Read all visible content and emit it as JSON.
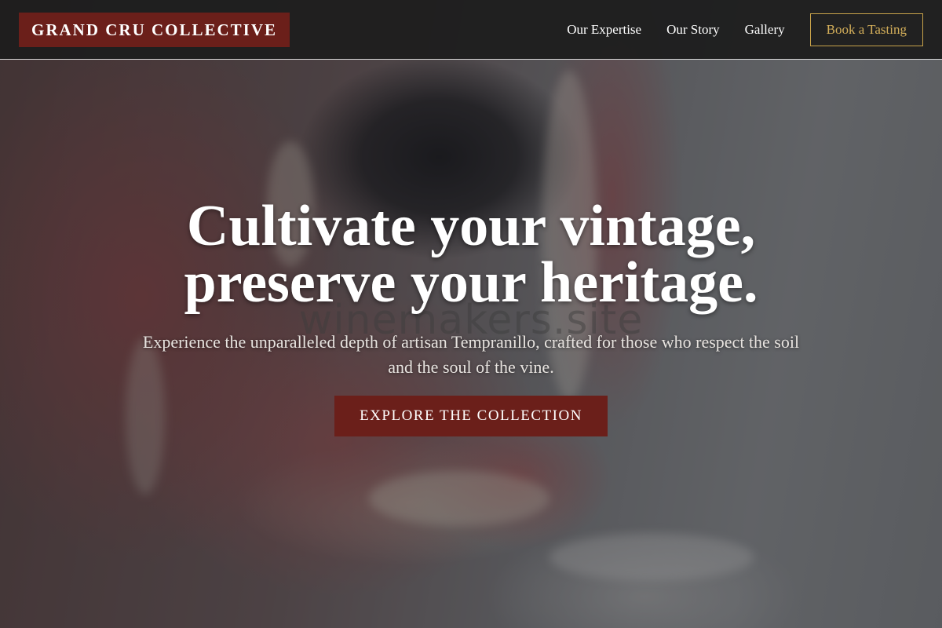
{
  "navbar": {
    "brand": "GRAND CRU COLLECTIVE",
    "links": [
      {
        "label": "Our Expertise"
      },
      {
        "label": "Our Story"
      },
      {
        "label": "Gallery"
      }
    ],
    "cta_label": "Book a Tasting"
  },
  "hero": {
    "headline_line1": "Cultivate your vintage,",
    "headline_line2": "preserve your heritage.",
    "subtext": "Experience the unparalleled depth of artisan Tempranillo, crafted for those who respect the soil and the soul of the vine.",
    "cta_label": "EXPLORE THE COLLECTION",
    "watermark": "winemakers.site",
    "background_image": "hands-shaping-clay-photo"
  },
  "colors": {
    "brand_burgundy": "#6b1f1a",
    "accent_gold": "#d4af5a",
    "nav_background": "#1e1e1e"
  }
}
